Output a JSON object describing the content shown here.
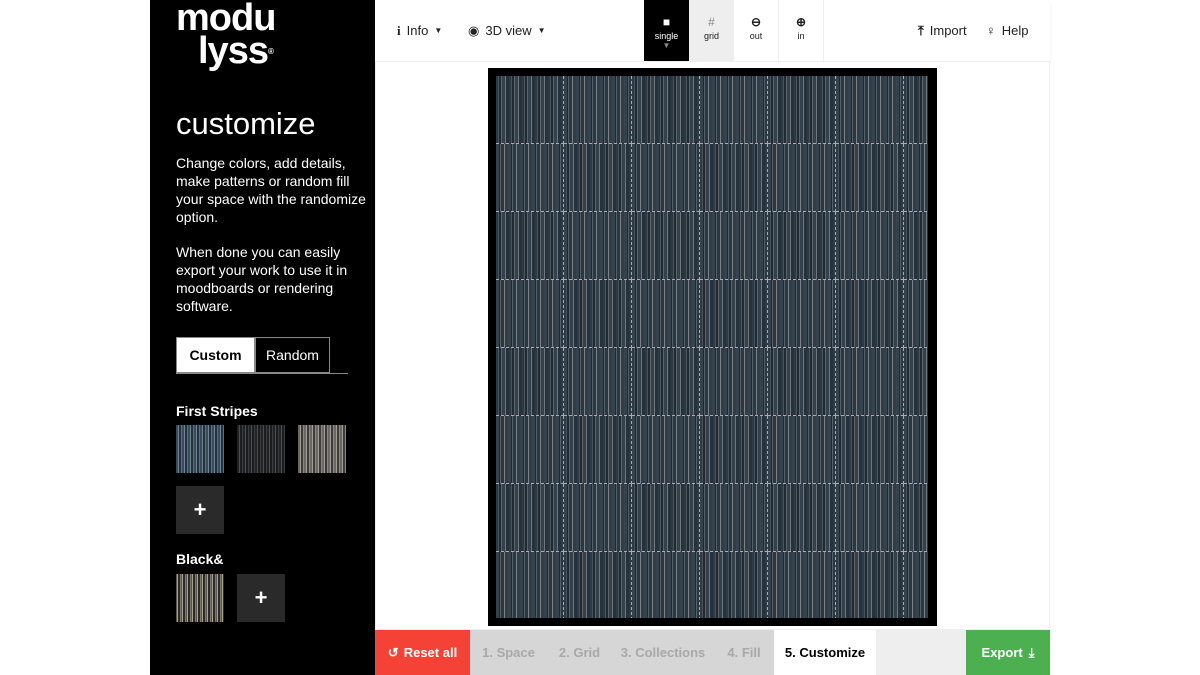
{
  "logo": {
    "line1": "modu",
    "line2": "lyss",
    "mark": "®"
  },
  "sidebar": {
    "title": "customize",
    "desc1": "Change colors, add details, make patterns or random fill your space with the randomize option.",
    "desc2": "When done you can easily export your work to use it in moodboards or rendering software.",
    "modes": [
      {
        "label": "Custom",
        "active": true
      },
      {
        "label": "Random",
        "active": false
      }
    ],
    "groups": [
      {
        "title": "First Stripes",
        "add": "+"
      },
      {
        "title": "Black&",
        "add": "+"
      }
    ]
  },
  "toolbar": {
    "info": "Info",
    "view3d": "3D view",
    "single": "single",
    "grid": "grid",
    "zoom_out": "out",
    "zoom_in": "in",
    "import": "Import",
    "help": "Help"
  },
  "bottombar": {
    "reset": "Reset all",
    "steps": [
      "1. Space",
      "2. Grid",
      "3. Collections",
      "4. Fill",
      "5. Customize"
    ],
    "active_step": "5. Customize",
    "export": "Export"
  },
  "colors": {
    "reset": "#f44336",
    "export": "#4caf50",
    "steps_bg": "#d6d6d6",
    "step_text": "#a8a8a8"
  }
}
